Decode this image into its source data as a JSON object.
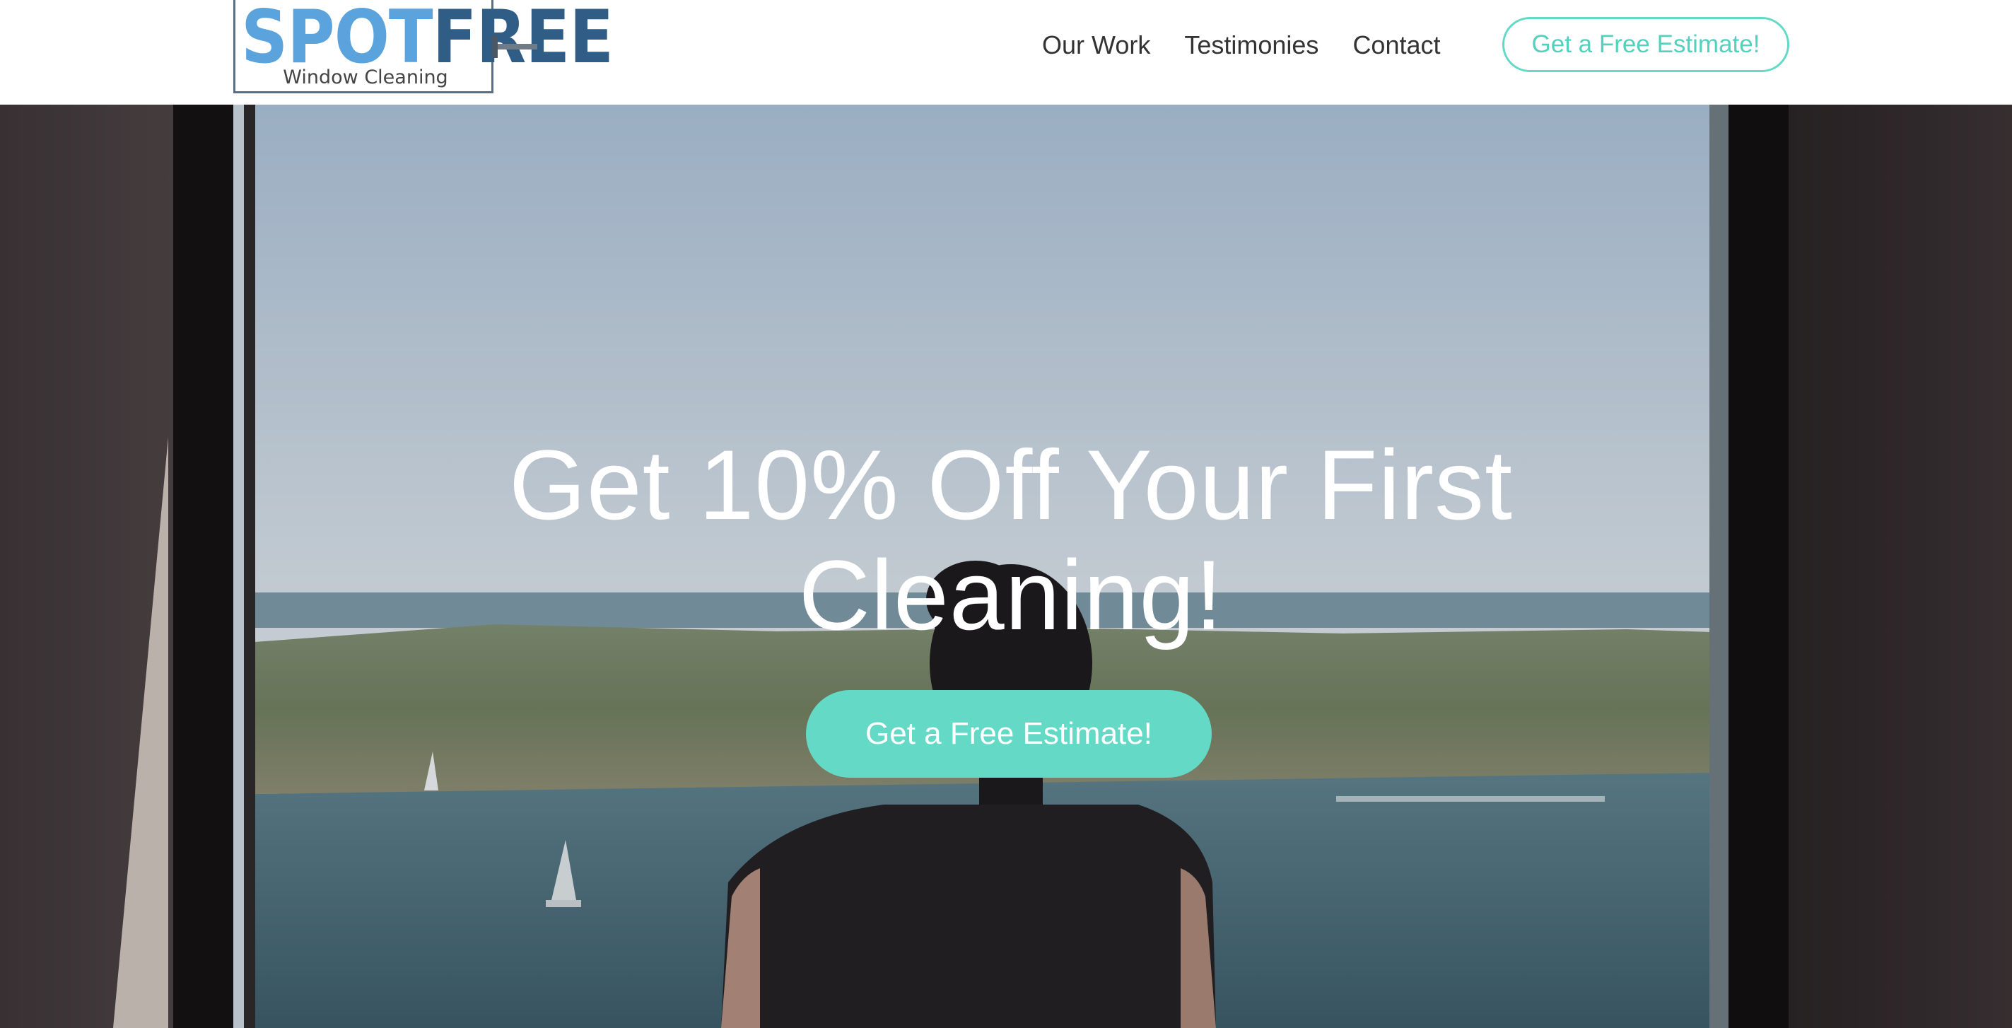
{
  "brand": {
    "logo_word_part1": "SPOT",
    "logo_word_part2": "FREE",
    "logo_subtitle": "Window Cleaning",
    "colors": {
      "spot_blue": "#5ba3dc",
      "free_navy": "#2f5d86"
    }
  },
  "nav": {
    "items": [
      {
        "label": "Our Work"
      },
      {
        "label": "Testimonies"
      },
      {
        "label": "Contact"
      }
    ],
    "cta_label": "Get a Free Estimate!"
  },
  "hero": {
    "headline_line1": "Get 10% Off Your First",
    "headline_line2": "Cleaning!",
    "cta_label": "Get a Free Estimate!",
    "background_image": "woman-silhouette-window-bay-view"
  },
  "theme": {
    "accent": "#63d9c6",
    "nav_text": "#333333",
    "hero_text": "#ffffff"
  }
}
